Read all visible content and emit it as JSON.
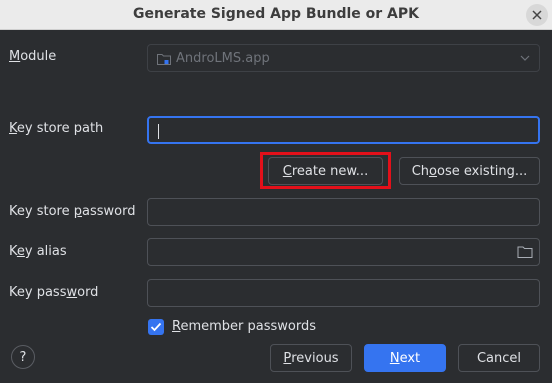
{
  "window": {
    "title": "Generate Signed App Bundle or APK"
  },
  "module": {
    "label_mnemonic": "M",
    "label_rest": "odule",
    "value": "AndroLMS.app"
  },
  "key_store_path": {
    "label_mnemonic": "K",
    "label_rest": "ey store path",
    "value": ""
  },
  "buttons": {
    "create_new_mnemonic": "C",
    "create_new_rest": "reate new...",
    "choose_existing_pre": "Ch",
    "choose_existing_mnemonic": "o",
    "choose_existing_rest": "ose existing...",
    "previous_mnemonic": "P",
    "previous_rest": "revious",
    "next_mnemonic": "N",
    "next_rest": "ext",
    "cancel": "Cancel"
  },
  "key_store_password": {
    "label_pre": "Key store ",
    "label_mnemonic": "p",
    "label_rest": "assword",
    "value": ""
  },
  "key_alias": {
    "label_pre": "K",
    "label_mnemonic": "e",
    "label_rest": "y alias",
    "value": ""
  },
  "key_password": {
    "label_pre": "Key pass",
    "label_mnemonic": "w",
    "label_rest": "ord",
    "value": ""
  },
  "remember": {
    "label_mnemonic": "R",
    "label_rest": "emember passwords",
    "checked": true
  },
  "help": {
    "glyph": "?"
  },
  "icons": [
    "close-icon",
    "module-icon",
    "chevron-down-icon",
    "folder-icon",
    "checkmark-icon",
    "help-icon"
  ],
  "colors": {
    "background": "#2b2d30",
    "accent": "#3574f0",
    "highlight": "#e3101a",
    "titlebar": "#ebebeb"
  }
}
